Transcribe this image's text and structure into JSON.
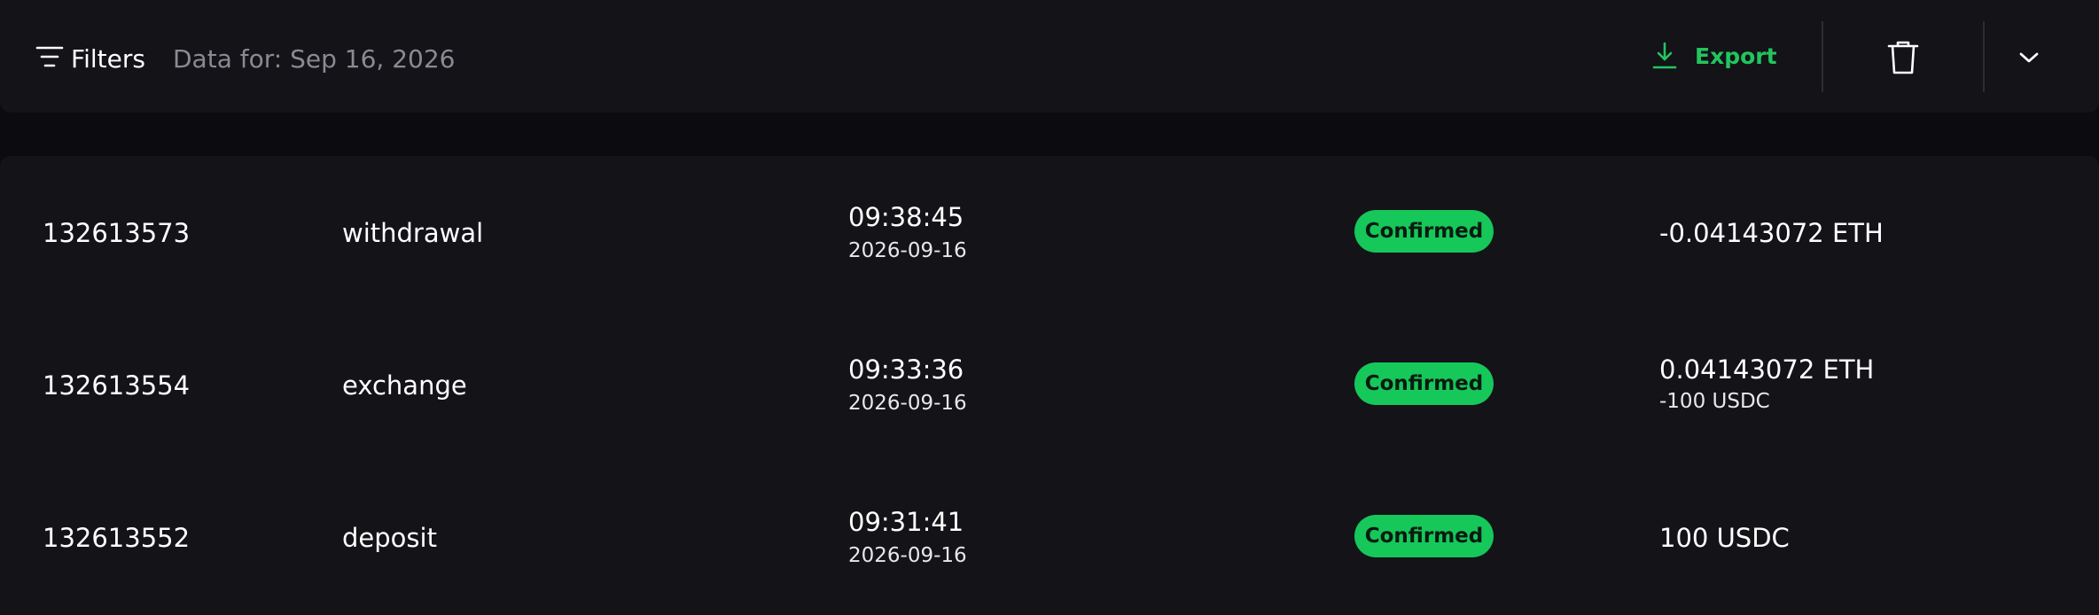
{
  "toolbar": {
    "filters_label": "Filters",
    "date_label": "Data for: Sep 16, 2026",
    "export_label": "Export",
    "icons": [
      "filter-icon",
      "download-icon",
      "trash-icon",
      "chevron-down-icon"
    ],
    "accent_color": "#22c55e"
  },
  "transactions": [
    {
      "id": "132613573",
      "type": "withdrawal",
      "time": "09:38:45",
      "date": "2026-09-16",
      "status": "Confirmed",
      "amount": "-0.04143072 ETH",
      "amount_secondary": ""
    },
    {
      "id": "132613554",
      "type": "exchange",
      "time": "09:33:36",
      "date": "2026-09-16",
      "status": "Confirmed",
      "amount": "0.04143072 ETH",
      "amount_secondary": "-100 USDC"
    },
    {
      "id": "132613552",
      "type": "deposit",
      "time": "09:31:41",
      "date": "2026-09-16",
      "status": "Confirmed",
      "amount": "100 USDC",
      "amount_secondary": ""
    }
  ],
  "status_color": "#16c75a"
}
